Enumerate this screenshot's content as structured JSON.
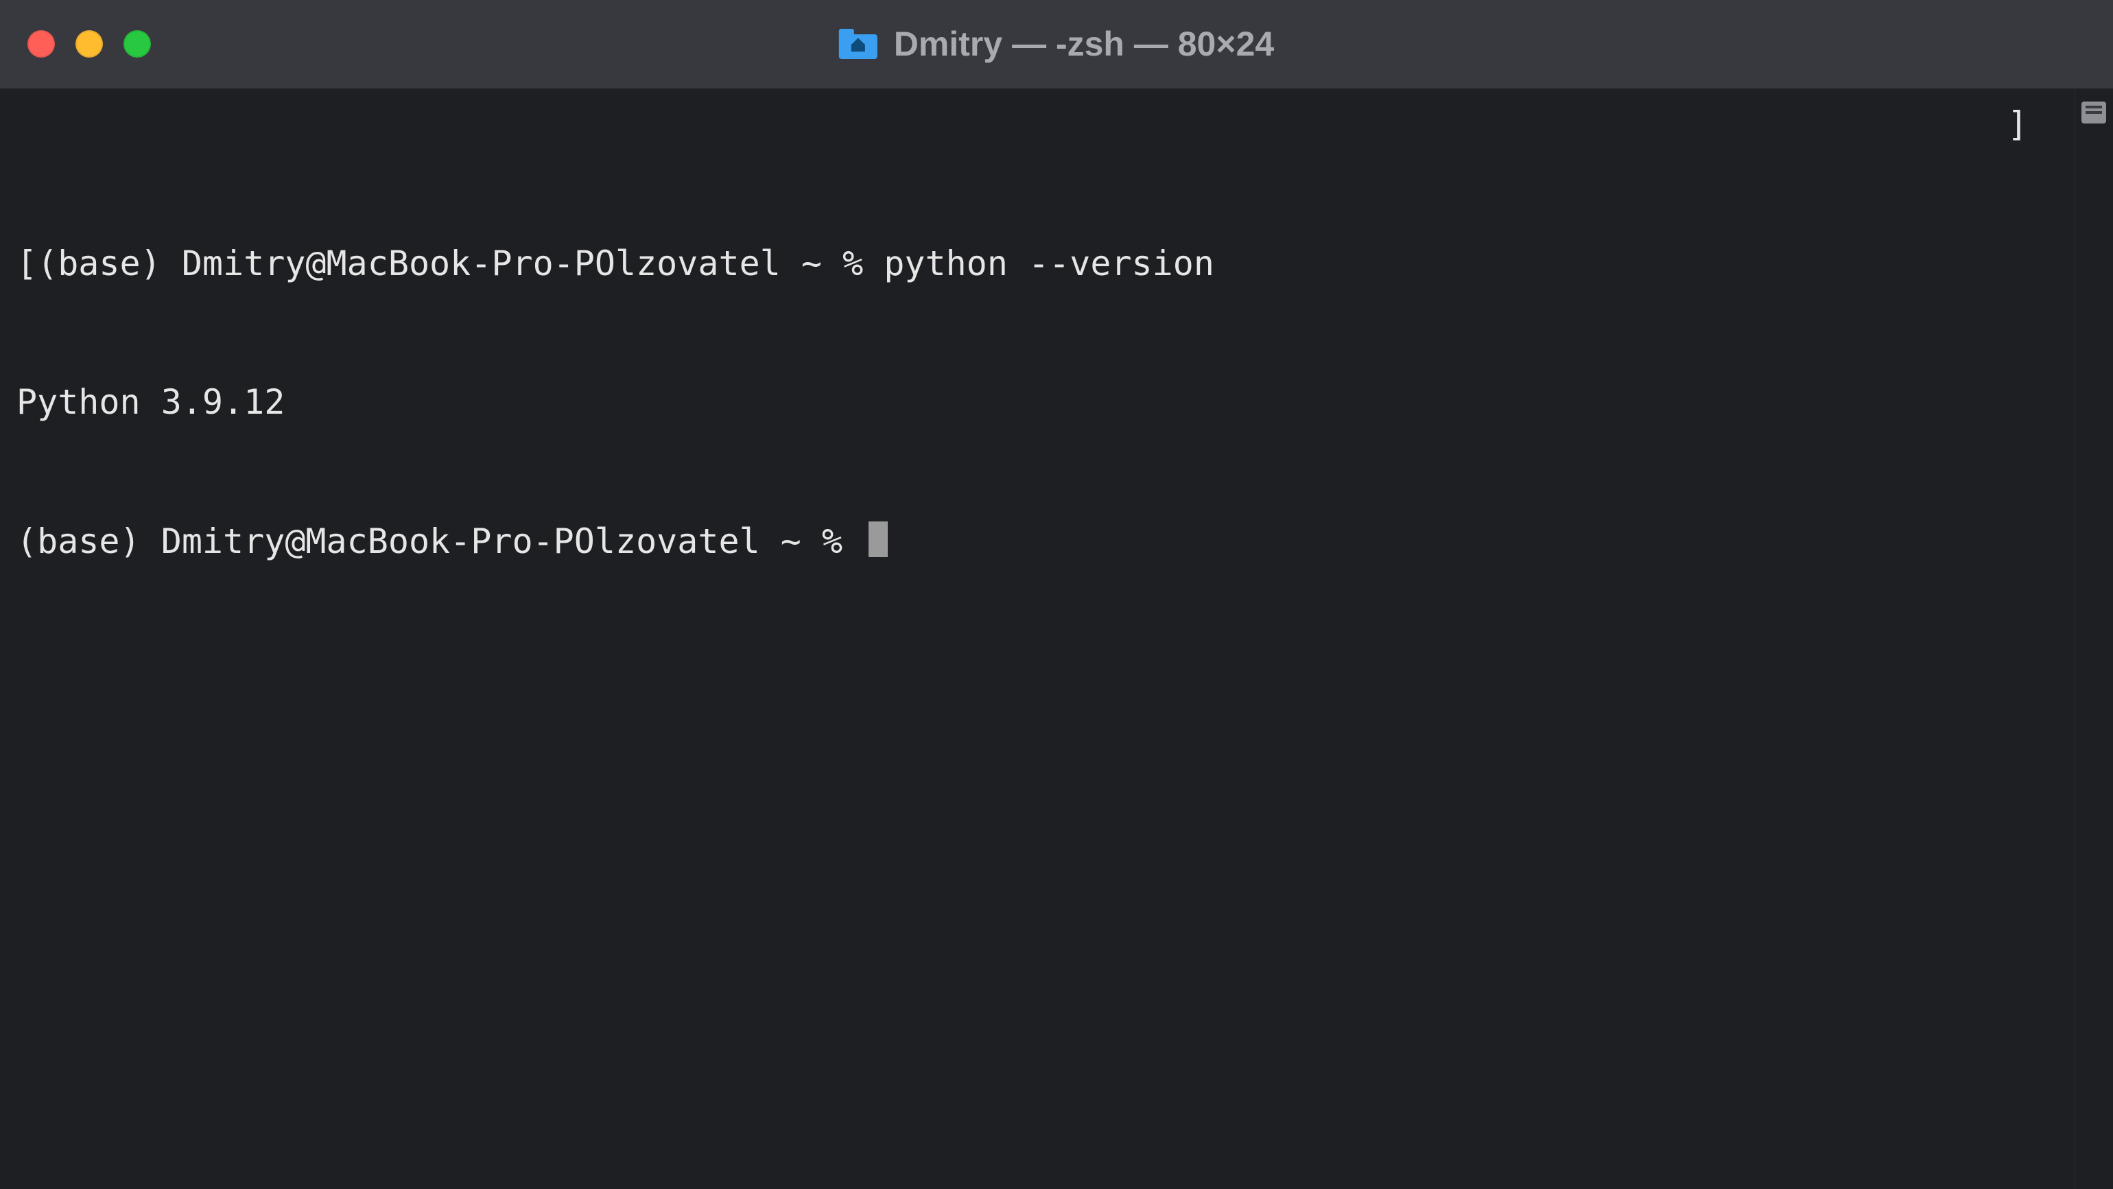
{
  "window": {
    "title": "Dmitry — -zsh — 80×24"
  },
  "terminal": {
    "line1_prompt": "[(base) Dmitry@MacBook-Pro-POlzovatel ~ % ",
    "line1_cmd": "python --version",
    "line2_output": "Python 3.9.12",
    "line3_prompt": "(base) Dmitry@MacBook-Pro-POlzovatel ~ % ",
    "right_bracket": "]"
  }
}
